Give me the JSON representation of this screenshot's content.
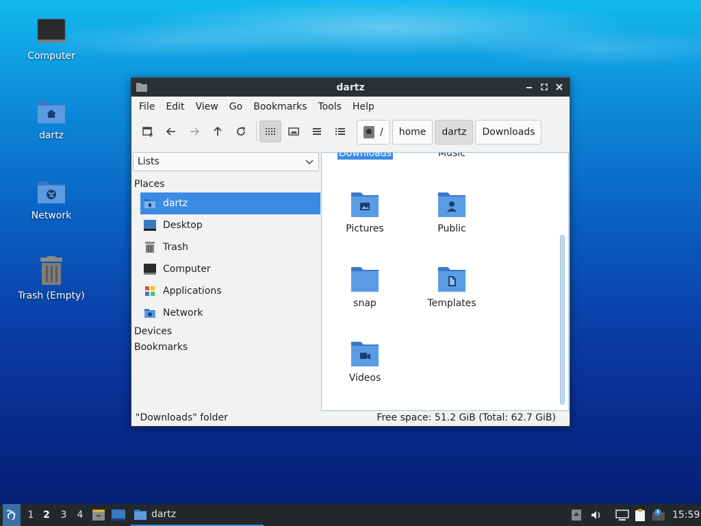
{
  "desktop": {
    "icons": [
      {
        "label": "Computer"
      },
      {
        "label": "dartz"
      },
      {
        "label": "Network"
      },
      {
        "label": "Trash (Empty)"
      }
    ]
  },
  "window": {
    "title": "dartz",
    "menu": [
      "File",
      "Edit",
      "View",
      "Go",
      "Bookmarks",
      "Tools",
      "Help"
    ],
    "path": [
      "/",
      "home",
      "dartz",
      "Downloads"
    ],
    "sidebar": {
      "mode": "Lists",
      "places_title": "Places",
      "places": [
        "dartz",
        "Desktop",
        "Trash",
        "Computer",
        "Applications",
        "Network"
      ],
      "devices_title": "Devices",
      "bookmarks_title": "Bookmarks"
    },
    "files": {
      "partial_top": [
        "Downloads",
        "Music"
      ],
      "items": [
        "Pictures",
        "Public",
        "snap",
        "Templates",
        "Videos"
      ]
    },
    "status": {
      "left": "\"Downloads\" folder",
      "right": "Free space: 51.2 GiB (Total: 62.7 GiB)"
    }
  },
  "taskbar": {
    "workspaces": [
      "1",
      "2",
      "3",
      "4"
    ],
    "active_workspace": "2",
    "task": "dartz",
    "clock": "15:59"
  },
  "colors": {
    "accent": "#3c8be3",
    "folder": "#4a8fd9",
    "titlebar": "#2b3035"
  }
}
